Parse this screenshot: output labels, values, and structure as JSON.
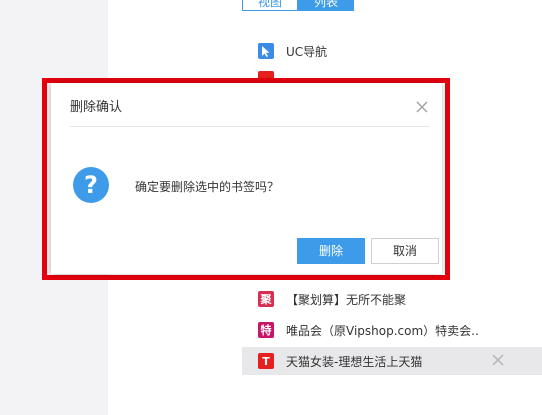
{
  "view_toggle": {
    "left_label": "视图",
    "right_label": "列表"
  },
  "bookmarks": [
    {
      "label": "UC导航",
      "icon": "cursor-icon"
    },
    {
      "label": "【聚划算】无所不能聚",
      "icon": "ju-icon",
      "icon_text": "聚"
    },
    {
      "label": "唯品会（原Vipshop.com）特卖会..",
      "icon": "te-icon",
      "icon_text": "特"
    },
    {
      "label": "天猫女装-理想生活上天猫",
      "icon": "tmall-icon",
      "icon_text": "T",
      "selected": true
    }
  ],
  "dialog": {
    "title": "删除确认",
    "message": "确定要删除选中的书签吗？",
    "confirm_label": "删除",
    "cancel_label": "取消",
    "icon": "question-icon"
  },
  "colors": {
    "accent": "#3d9be9",
    "highlight": "#e5000e"
  }
}
